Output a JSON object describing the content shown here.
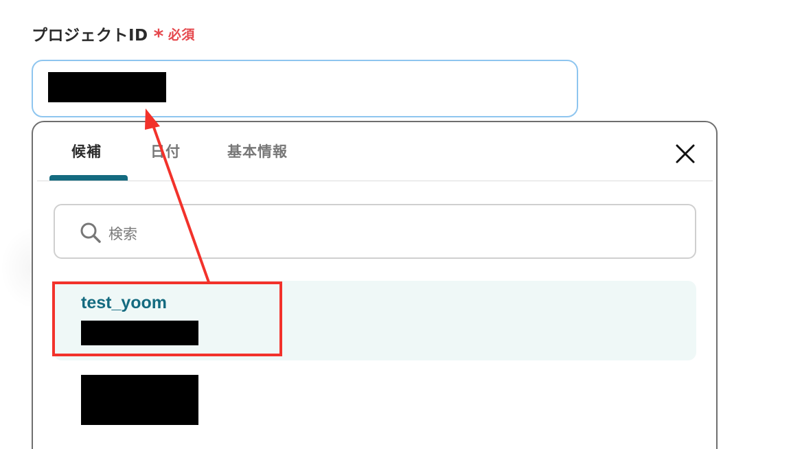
{
  "field": {
    "label": "プロジェクトID",
    "required_mark": "*",
    "required_text": "必須"
  },
  "tabs": [
    {
      "label": "候補",
      "active": true
    },
    {
      "label": "日付",
      "active": false
    },
    {
      "label": "基本情報",
      "active": false
    }
  ],
  "search": {
    "placeholder": "検索"
  },
  "options": [
    {
      "title": "test_yoom",
      "highlighted": true
    },
    {
      "title": "",
      "highlighted": false
    }
  ],
  "colors": {
    "accent": "#146b80",
    "required": "#e5484d",
    "annotation": "#f2322b",
    "input_border": "#8ec5ef",
    "highlight_bg": "#eff8f7"
  },
  "icons": {
    "close": "close-icon",
    "search": "search-icon"
  }
}
